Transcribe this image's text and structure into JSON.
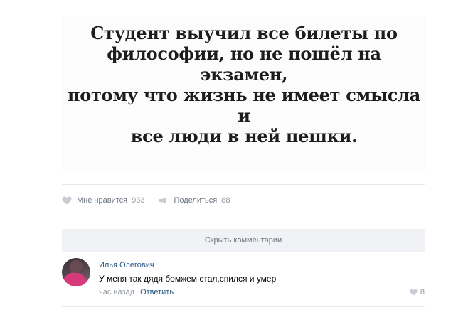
{
  "quote": {
    "text": "Студент выучил все билеты по\nфилософии, но не пошёл на экзамен,\nпотому что жизнь не имеет смысла и\nвсе люди в ней пешки."
  },
  "actions": {
    "like_label": "Мне нравится",
    "like_count": "933",
    "share_label": "Поделиться",
    "share_count": "88"
  },
  "comments_toggle": {
    "label": "Скрыть комментарии"
  },
  "comment": {
    "author": "Илья Олегович",
    "text": "У меня так дядя бомжем стал,спился и умер",
    "time": "час назад",
    "reply_label": "Ответить",
    "like_count": "8"
  },
  "colors": {
    "link": "#2a5885",
    "muted": "#939aa3",
    "button_bg": "#f0f2f5",
    "divider": "#e7e8ec"
  },
  "icons": {
    "like": "heart-icon",
    "share": "megaphone-icon",
    "comment_like": "heart-icon"
  }
}
